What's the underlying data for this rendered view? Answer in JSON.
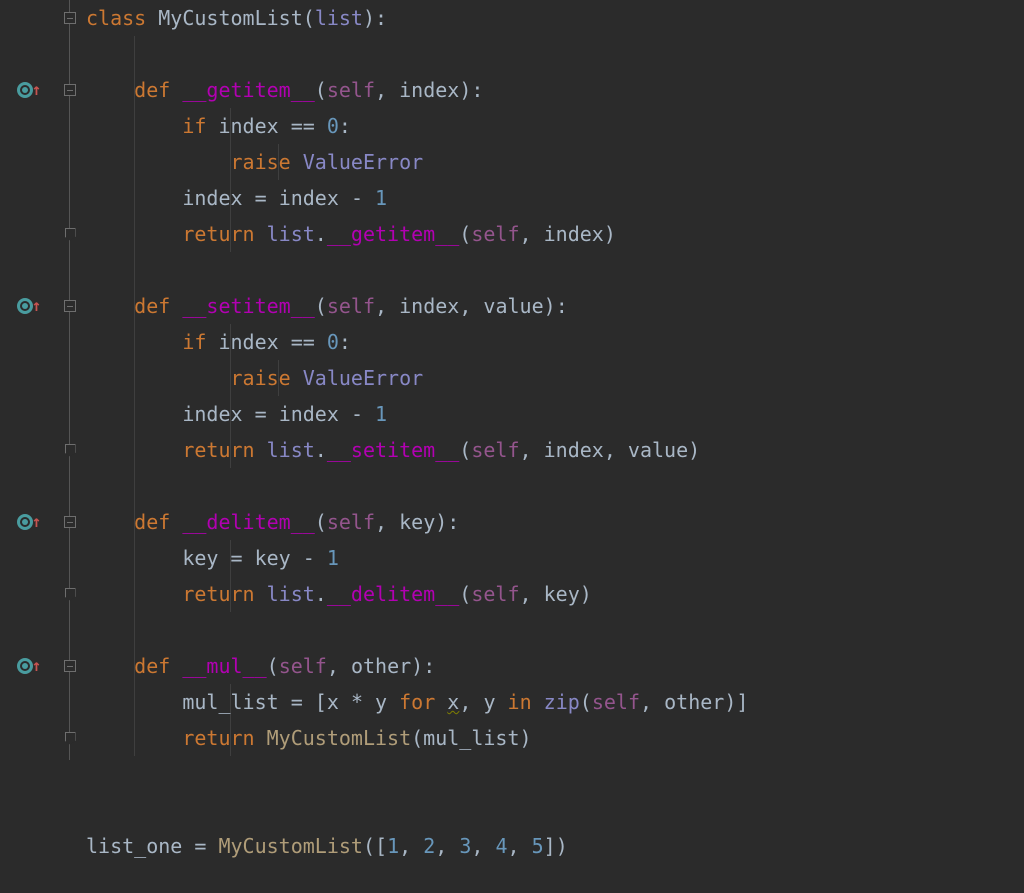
{
  "code": {
    "class_kw": "class",
    "class_name": "MyCustomList",
    "base_class": "list",
    "def_kw": "def",
    "if_kw": "if",
    "raise_kw": "raise",
    "return_kw": "return",
    "for_kw": "for",
    "in_kw": "in",
    "self": "self",
    "getitem": "__getitem__",
    "setitem": "__setitem__",
    "delitem": "__delitem__",
    "mul": "__mul__",
    "index": "index",
    "value": "value",
    "key": "key",
    "other": "other",
    "value_error": "ValueError",
    "zero": "0",
    "one": "1",
    "two": "2",
    "three": "3",
    "four": "4",
    "five": "5",
    "eq": "==",
    "assign": "=",
    "minus": "-",
    "star": "*",
    "list": "list",
    "mul_list": "mul_list",
    "x": "x",
    "y": "y",
    "zip": "zip",
    "list_one": "list_one",
    "lparen": "(",
    "rparen": ")",
    "lbrack": "[",
    "rbrack": "]",
    "colon": ":",
    "comma": ","
  }
}
